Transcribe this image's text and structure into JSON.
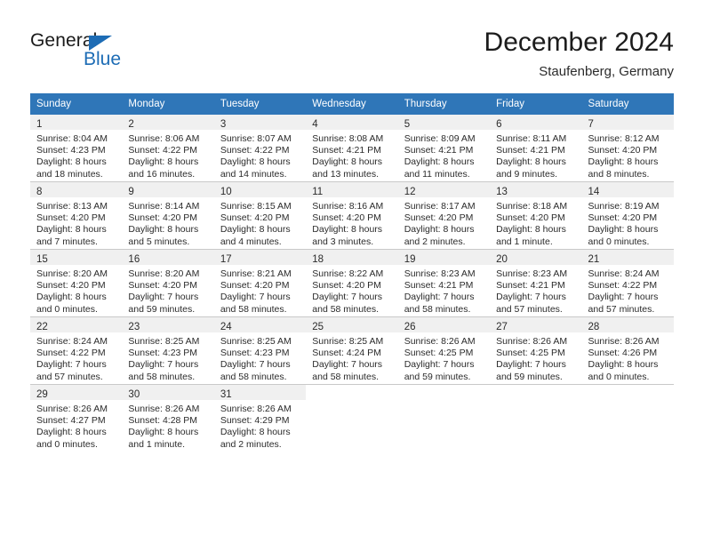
{
  "brand": {
    "name_top": "General",
    "name_bottom": "Blue",
    "triangle_color": "#1d6cb5",
    "text_color": "#1a1a1a"
  },
  "header": {
    "title": "December 2024",
    "subtitle": "Staufenberg, Germany"
  },
  "theme": {
    "header_row_bg": "#2f76b8",
    "header_row_text": "#ffffff",
    "daynum_band_bg": "#f0f0f0",
    "grid_line": "#c9c9c9",
    "body_text": "#2b2b2b"
  },
  "weekday_headers": [
    "Sunday",
    "Monday",
    "Tuesday",
    "Wednesday",
    "Thursday",
    "Friday",
    "Saturday"
  ],
  "weeks": [
    [
      {
        "day": "1",
        "sunrise": "Sunrise: 8:04 AM",
        "sunset": "Sunset: 4:23 PM",
        "daylight1": "Daylight: 8 hours",
        "daylight2": "and 18 minutes."
      },
      {
        "day": "2",
        "sunrise": "Sunrise: 8:06 AM",
        "sunset": "Sunset: 4:22 PM",
        "daylight1": "Daylight: 8 hours",
        "daylight2": "and 16 minutes."
      },
      {
        "day": "3",
        "sunrise": "Sunrise: 8:07 AM",
        "sunset": "Sunset: 4:22 PM",
        "daylight1": "Daylight: 8 hours",
        "daylight2": "and 14 minutes."
      },
      {
        "day": "4",
        "sunrise": "Sunrise: 8:08 AM",
        "sunset": "Sunset: 4:21 PM",
        "daylight1": "Daylight: 8 hours",
        "daylight2": "and 13 minutes."
      },
      {
        "day": "5",
        "sunrise": "Sunrise: 8:09 AM",
        "sunset": "Sunset: 4:21 PM",
        "daylight1": "Daylight: 8 hours",
        "daylight2": "and 11 minutes."
      },
      {
        "day": "6",
        "sunrise": "Sunrise: 8:11 AM",
        "sunset": "Sunset: 4:21 PM",
        "daylight1": "Daylight: 8 hours",
        "daylight2": "and 9 minutes."
      },
      {
        "day": "7",
        "sunrise": "Sunrise: 8:12 AM",
        "sunset": "Sunset: 4:20 PM",
        "daylight1": "Daylight: 8 hours",
        "daylight2": "and 8 minutes."
      }
    ],
    [
      {
        "day": "8",
        "sunrise": "Sunrise: 8:13 AM",
        "sunset": "Sunset: 4:20 PM",
        "daylight1": "Daylight: 8 hours",
        "daylight2": "and 7 minutes."
      },
      {
        "day": "9",
        "sunrise": "Sunrise: 8:14 AM",
        "sunset": "Sunset: 4:20 PM",
        "daylight1": "Daylight: 8 hours",
        "daylight2": "and 5 minutes."
      },
      {
        "day": "10",
        "sunrise": "Sunrise: 8:15 AM",
        "sunset": "Sunset: 4:20 PM",
        "daylight1": "Daylight: 8 hours",
        "daylight2": "and 4 minutes."
      },
      {
        "day": "11",
        "sunrise": "Sunrise: 8:16 AM",
        "sunset": "Sunset: 4:20 PM",
        "daylight1": "Daylight: 8 hours",
        "daylight2": "and 3 minutes."
      },
      {
        "day": "12",
        "sunrise": "Sunrise: 8:17 AM",
        "sunset": "Sunset: 4:20 PM",
        "daylight1": "Daylight: 8 hours",
        "daylight2": "and 2 minutes."
      },
      {
        "day": "13",
        "sunrise": "Sunrise: 8:18 AM",
        "sunset": "Sunset: 4:20 PM",
        "daylight1": "Daylight: 8 hours",
        "daylight2": "and 1 minute."
      },
      {
        "day": "14",
        "sunrise": "Sunrise: 8:19 AM",
        "sunset": "Sunset: 4:20 PM",
        "daylight1": "Daylight: 8 hours",
        "daylight2": "and 0 minutes."
      }
    ],
    [
      {
        "day": "15",
        "sunrise": "Sunrise: 8:20 AM",
        "sunset": "Sunset: 4:20 PM",
        "daylight1": "Daylight: 8 hours",
        "daylight2": "and 0 minutes."
      },
      {
        "day": "16",
        "sunrise": "Sunrise: 8:20 AM",
        "sunset": "Sunset: 4:20 PM",
        "daylight1": "Daylight: 7 hours",
        "daylight2": "and 59 minutes."
      },
      {
        "day": "17",
        "sunrise": "Sunrise: 8:21 AM",
        "sunset": "Sunset: 4:20 PM",
        "daylight1": "Daylight: 7 hours",
        "daylight2": "and 58 minutes."
      },
      {
        "day": "18",
        "sunrise": "Sunrise: 8:22 AM",
        "sunset": "Sunset: 4:20 PM",
        "daylight1": "Daylight: 7 hours",
        "daylight2": "and 58 minutes."
      },
      {
        "day": "19",
        "sunrise": "Sunrise: 8:23 AM",
        "sunset": "Sunset: 4:21 PM",
        "daylight1": "Daylight: 7 hours",
        "daylight2": "and 58 minutes."
      },
      {
        "day": "20",
        "sunrise": "Sunrise: 8:23 AM",
        "sunset": "Sunset: 4:21 PM",
        "daylight1": "Daylight: 7 hours",
        "daylight2": "and 57 minutes."
      },
      {
        "day": "21",
        "sunrise": "Sunrise: 8:24 AM",
        "sunset": "Sunset: 4:22 PM",
        "daylight1": "Daylight: 7 hours",
        "daylight2": "and 57 minutes."
      }
    ],
    [
      {
        "day": "22",
        "sunrise": "Sunrise: 8:24 AM",
        "sunset": "Sunset: 4:22 PM",
        "daylight1": "Daylight: 7 hours",
        "daylight2": "and 57 minutes."
      },
      {
        "day": "23",
        "sunrise": "Sunrise: 8:25 AM",
        "sunset": "Sunset: 4:23 PM",
        "daylight1": "Daylight: 7 hours",
        "daylight2": "and 58 minutes."
      },
      {
        "day": "24",
        "sunrise": "Sunrise: 8:25 AM",
        "sunset": "Sunset: 4:23 PM",
        "daylight1": "Daylight: 7 hours",
        "daylight2": "and 58 minutes."
      },
      {
        "day": "25",
        "sunrise": "Sunrise: 8:25 AM",
        "sunset": "Sunset: 4:24 PM",
        "daylight1": "Daylight: 7 hours",
        "daylight2": "and 58 minutes."
      },
      {
        "day": "26",
        "sunrise": "Sunrise: 8:26 AM",
        "sunset": "Sunset: 4:25 PM",
        "daylight1": "Daylight: 7 hours",
        "daylight2": "and 59 minutes."
      },
      {
        "day": "27",
        "sunrise": "Sunrise: 8:26 AM",
        "sunset": "Sunset: 4:25 PM",
        "daylight1": "Daylight: 7 hours",
        "daylight2": "and 59 minutes."
      },
      {
        "day": "28",
        "sunrise": "Sunrise: 8:26 AM",
        "sunset": "Sunset: 4:26 PM",
        "daylight1": "Daylight: 8 hours",
        "daylight2": "and 0 minutes."
      }
    ],
    [
      {
        "day": "29",
        "sunrise": "Sunrise: 8:26 AM",
        "sunset": "Sunset: 4:27 PM",
        "daylight1": "Daylight: 8 hours",
        "daylight2": "and 0 minutes."
      },
      {
        "day": "30",
        "sunrise": "Sunrise: 8:26 AM",
        "sunset": "Sunset: 4:28 PM",
        "daylight1": "Daylight: 8 hours",
        "daylight2": "and 1 minute."
      },
      {
        "day": "31",
        "sunrise": "Sunrise: 8:26 AM",
        "sunset": "Sunset: 4:29 PM",
        "daylight1": "Daylight: 8 hours",
        "daylight2": "and 2 minutes."
      },
      {
        "day": "",
        "sunrise": "",
        "sunset": "",
        "daylight1": "",
        "daylight2": ""
      },
      {
        "day": "",
        "sunrise": "",
        "sunset": "",
        "daylight1": "",
        "daylight2": ""
      },
      {
        "day": "",
        "sunrise": "",
        "sunset": "",
        "daylight1": "",
        "daylight2": ""
      },
      {
        "day": "",
        "sunrise": "",
        "sunset": "",
        "daylight1": "",
        "daylight2": ""
      }
    ]
  ]
}
